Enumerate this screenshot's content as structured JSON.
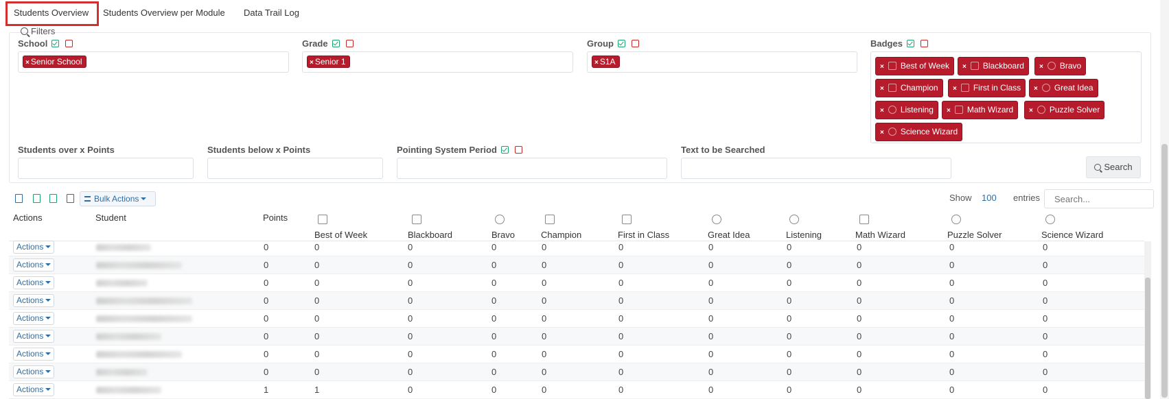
{
  "tabs": [
    {
      "label": "Students Overview",
      "active": true
    },
    {
      "label": "Students Overview per Module",
      "active": false
    },
    {
      "label": "Data Trail Log",
      "active": false
    }
  ],
  "filters": {
    "title": "Filters",
    "school": {
      "label": "School",
      "tags": [
        "Senior School"
      ]
    },
    "grade": {
      "label": "Grade",
      "tags": [
        "Senior 1"
      ]
    },
    "group": {
      "label": "Group",
      "tags": [
        "S1A"
      ]
    },
    "badges": {
      "label": "Badges",
      "tags": [
        "Best of Week",
        "Blackboard",
        "Bravo",
        "Champion",
        "First in Class",
        "Great Idea",
        "Listening",
        "Math Wizard",
        "Puzzle Solver",
        "Science Wizard"
      ]
    },
    "over_points": {
      "label": "Students over x Points",
      "value": ""
    },
    "below_points": {
      "label": "Students below x Points",
      "value": ""
    },
    "period": {
      "label": "Pointing System Period",
      "value": ""
    },
    "text_search": {
      "label": "Text to be Searched",
      "value": ""
    },
    "search_button": "Search"
  },
  "toolbar": {
    "icons": [
      "print-icon",
      "excel-icon",
      "csv-icon",
      "copy-icon"
    ],
    "bulk_actions": "Bulk Actions",
    "show_label": "Show",
    "show_value": "100",
    "entries_label": "entries",
    "search_placeholder": "Search..."
  },
  "table": {
    "columns": [
      "Actions",
      "Student",
      "Points",
      "Best of Week",
      "Blackboard",
      "Bravo",
      "Champion",
      "First in Class",
      "Great Idea",
      "Listening",
      "Math Wizard",
      "Puzzle Solver",
      "Science Wizard"
    ],
    "action_label": "Actions",
    "rows": [
      {
        "points": "0",
        "values": [
          "0",
          "0",
          "0",
          "0",
          "0",
          "0",
          "0",
          "0",
          "0",
          "0"
        ]
      },
      {
        "points": "0",
        "values": [
          "0",
          "0",
          "0",
          "0",
          "0",
          "0",
          "0",
          "0",
          "0",
          "0"
        ]
      },
      {
        "points": "0",
        "values": [
          "0",
          "0",
          "0",
          "0",
          "0",
          "0",
          "0",
          "0",
          "0",
          "0"
        ]
      },
      {
        "points": "0",
        "values": [
          "0",
          "0",
          "0",
          "0",
          "0",
          "0",
          "0",
          "0",
          "0",
          "0"
        ]
      },
      {
        "points": "0",
        "values": [
          "0",
          "0",
          "0",
          "0",
          "0",
          "0",
          "0",
          "0",
          "0",
          "0"
        ]
      },
      {
        "points": "0",
        "values": [
          "0",
          "0",
          "0",
          "0",
          "0",
          "0",
          "0",
          "0",
          "0",
          "0"
        ]
      },
      {
        "points": "0",
        "values": [
          "0",
          "0",
          "0",
          "0",
          "0",
          "0",
          "0",
          "0",
          "0",
          "0"
        ]
      },
      {
        "points": "0",
        "values": [
          "0",
          "0",
          "0",
          "0",
          "0",
          "0",
          "0",
          "0",
          "0",
          "0"
        ]
      },
      {
        "points": "1",
        "values": [
          "1",
          "0",
          "0",
          "0",
          "0",
          "0",
          "0",
          "0",
          "0",
          "0"
        ]
      }
    ]
  },
  "colors": {
    "accent": "#b71c2c",
    "link": "#2e6da4",
    "check": "#1aa56f",
    "highlight": "#d32f2f"
  }
}
